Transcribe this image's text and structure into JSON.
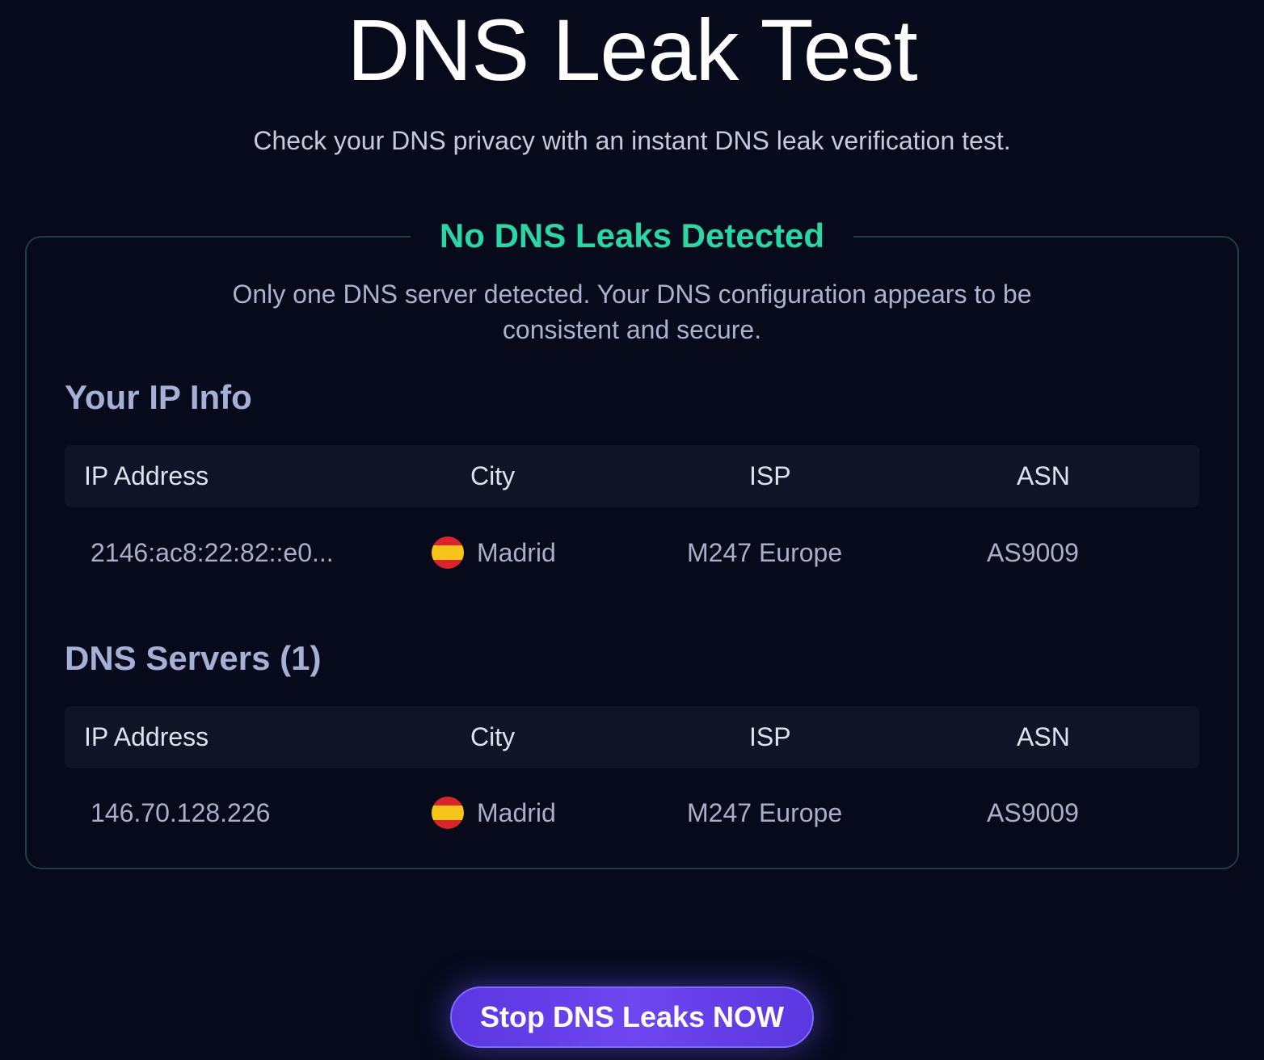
{
  "page": {
    "title": "DNS Leak Test",
    "subtitle": "Check your DNS privacy with an instant DNS leak verification test."
  },
  "result": {
    "status": "No DNS Leaks Detected",
    "description": "Only one DNS server detected. Your DNS configuration appears to be consistent and secure.",
    "status_color": "#2ad6a5"
  },
  "ip_info": {
    "heading": "Your IP Info",
    "columns": [
      "IP Address",
      "City",
      "ISP",
      "ASN"
    ],
    "rows": [
      {
        "ip": "2146:ac8:22:82::e0...",
        "flag": "spain-flag-icon",
        "city": "Madrid",
        "isp": "M247 Europe",
        "asn": "AS9009"
      }
    ]
  },
  "dns_servers": {
    "heading": "DNS Servers (1)",
    "columns": [
      "IP Address",
      "City",
      "ISP",
      "ASN"
    ],
    "rows": [
      {
        "ip": "146.70.128.226",
        "flag": "spain-flag-icon",
        "city": "Madrid",
        "isp": "M247 Europe",
        "asn": "AS9009"
      }
    ]
  },
  "cta": {
    "label": "Stop DNS Leaks NOW",
    "color": "#6d46f0"
  }
}
